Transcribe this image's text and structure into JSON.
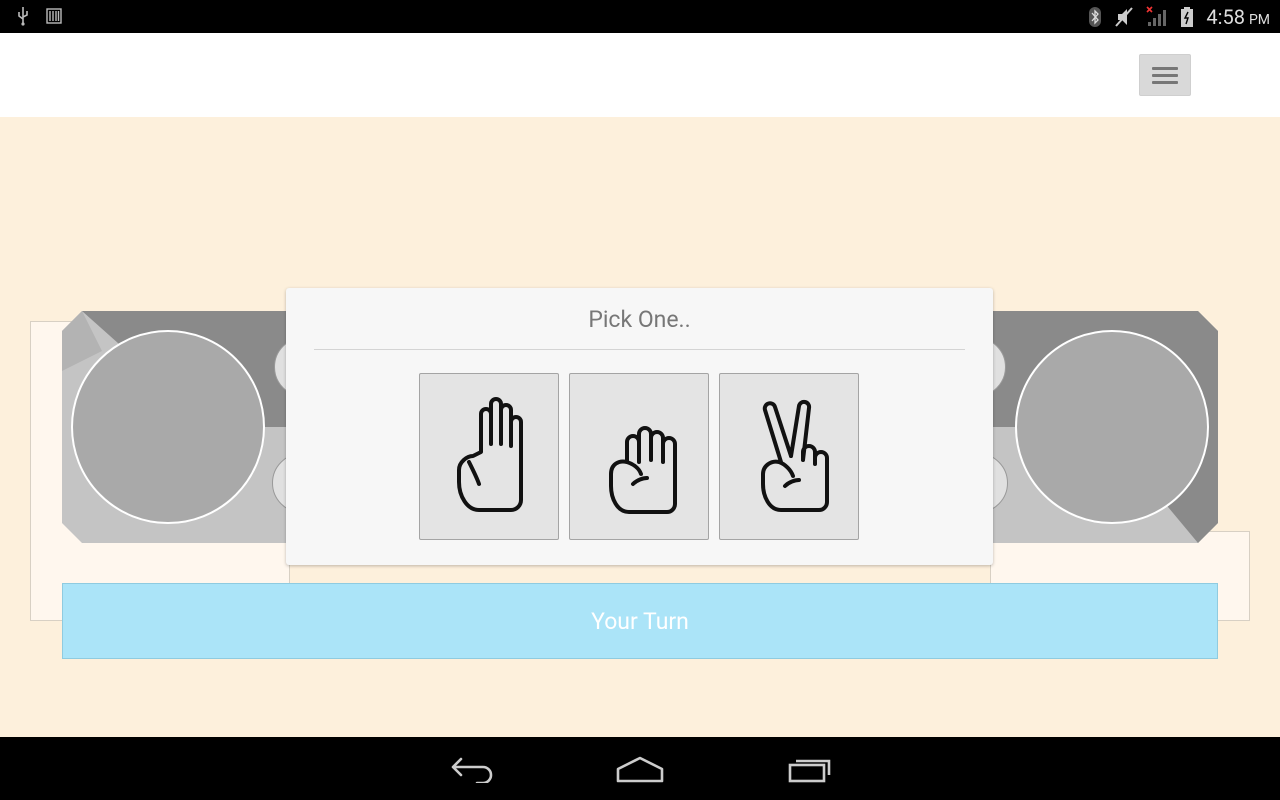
{
  "status_bar": {
    "left_icons": [
      "usb-icon",
      "barcode-icon"
    ],
    "right_icons": [
      "bluetooth-icon",
      "mute-icon",
      "signal-icon",
      "battery-icon"
    ],
    "time": "4:58",
    "ampm": "PM"
  },
  "app_bar": {
    "menu_icon": "menu-icon"
  },
  "dialog": {
    "title": "Pick One..",
    "choices": [
      {
        "name": "paper",
        "icon": "open-hand-icon"
      },
      {
        "name": "rock",
        "icon": "fist-icon"
      },
      {
        "name": "scissors",
        "icon": "peace-sign-icon"
      }
    ]
  },
  "turn_bar": {
    "label": "Your Turn"
  },
  "nav_bar": {
    "buttons": [
      "back-icon",
      "home-icon",
      "recent-apps-icon"
    ]
  },
  "colors": {
    "background": "#fdf0dc",
    "turn_bar": "#abe4f8",
    "panel_dark": "#8a8a8a",
    "panel_light": "#c4c4c4"
  }
}
